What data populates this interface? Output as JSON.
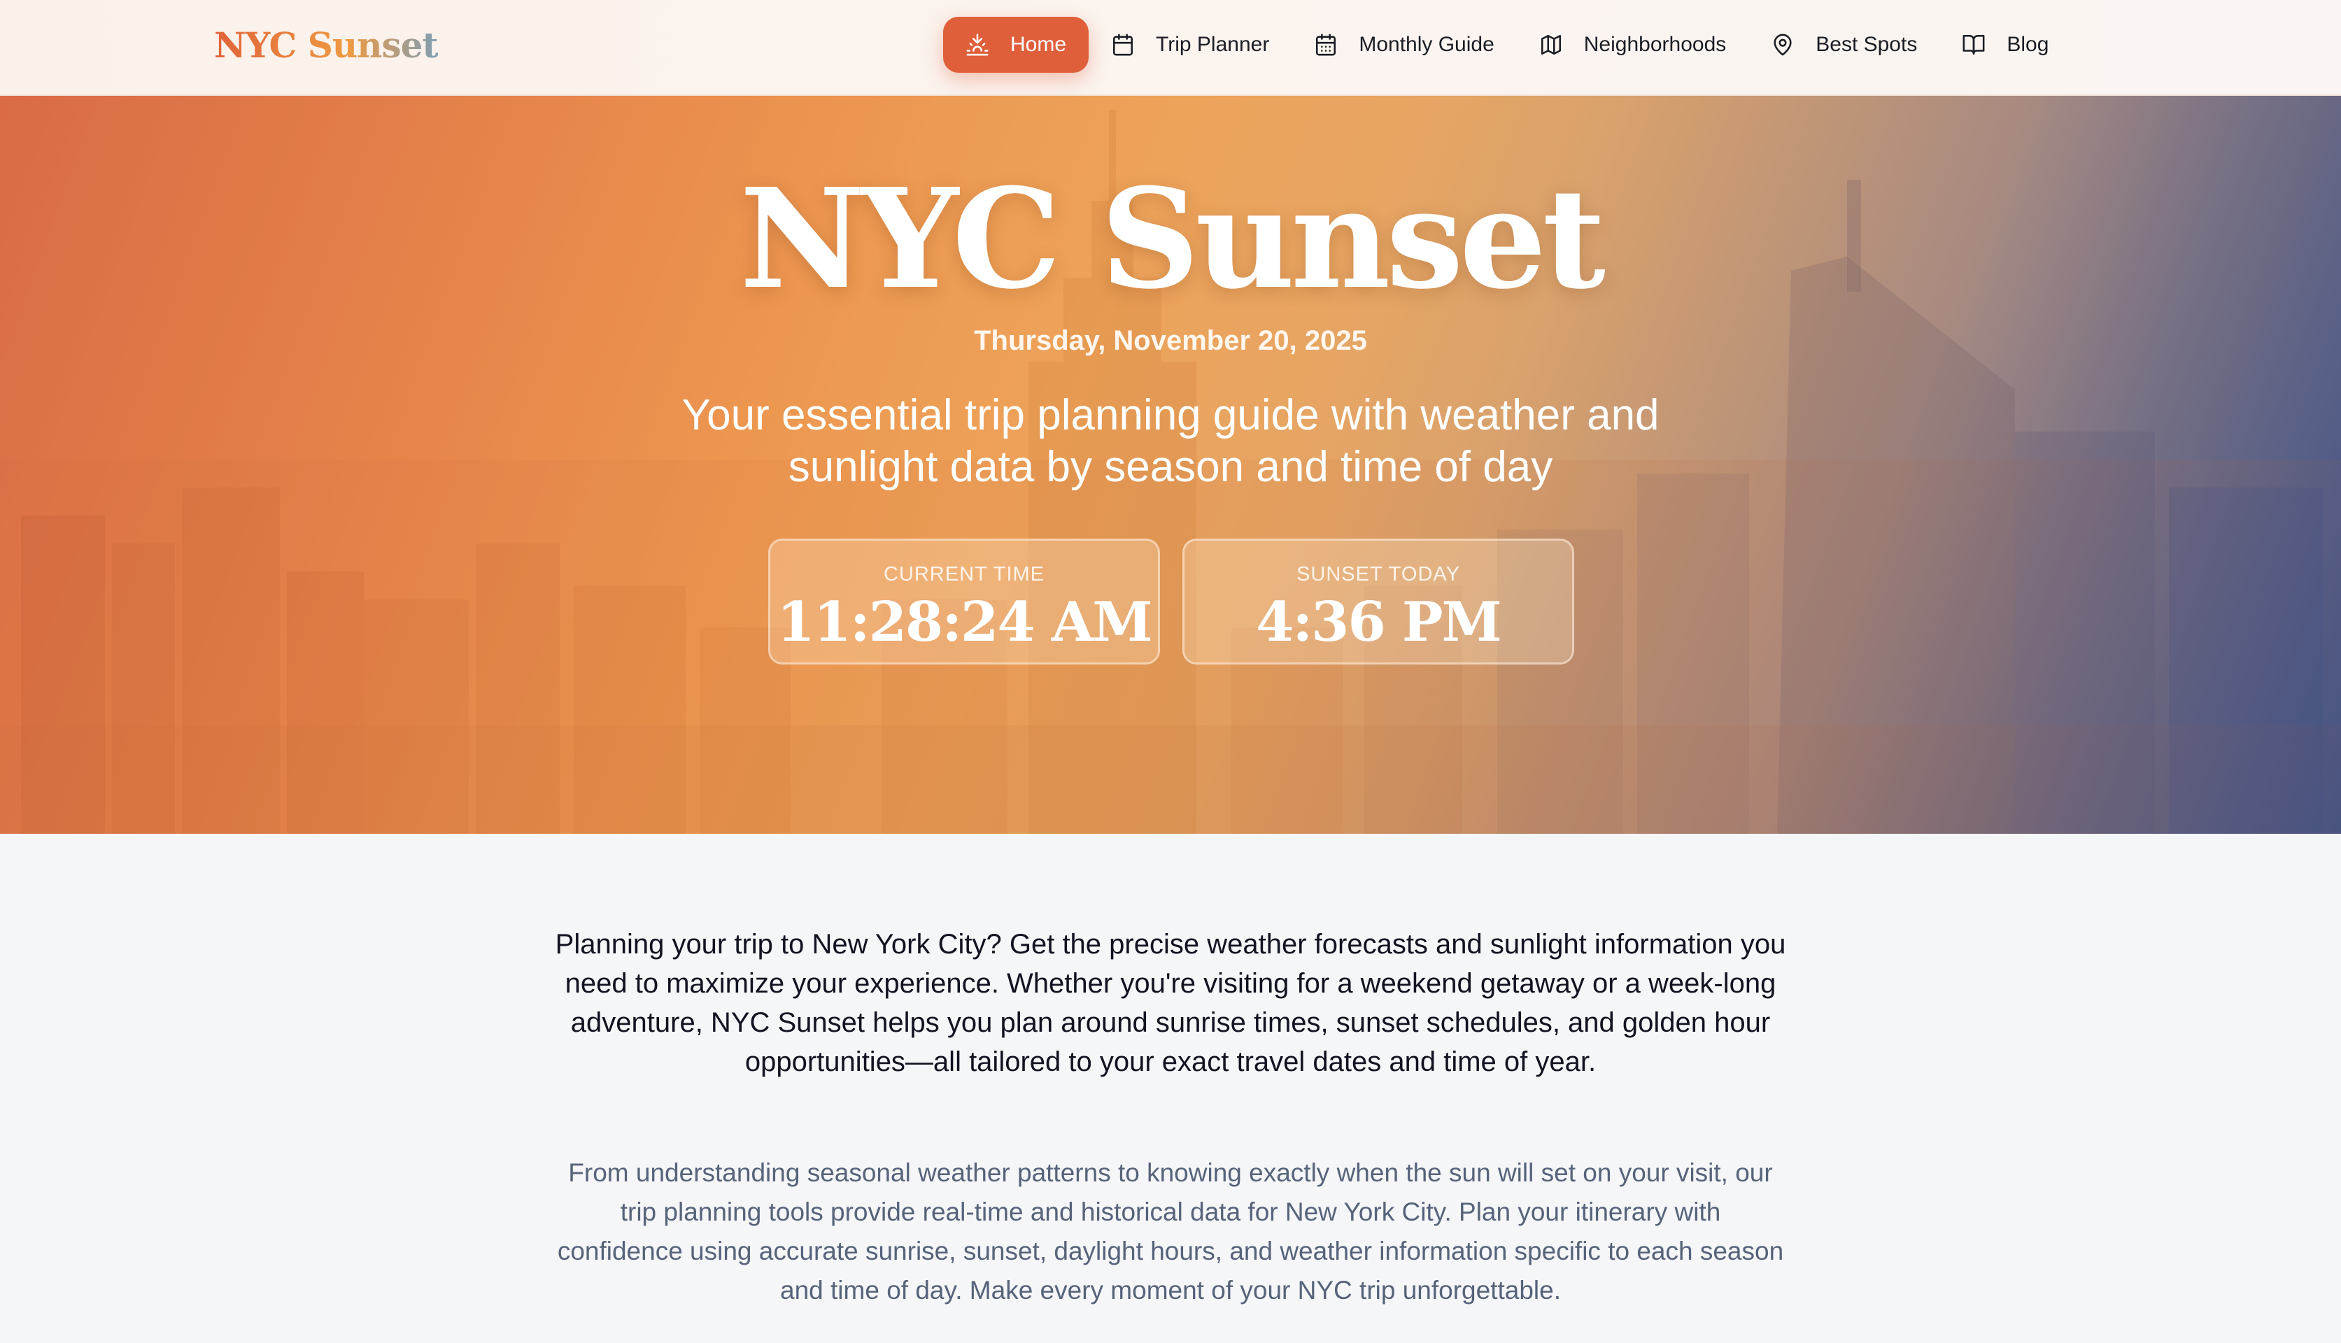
{
  "brand": "NYC Sunset",
  "nav": {
    "items": [
      {
        "label": "Home",
        "icon": "sunset-icon",
        "active": true
      },
      {
        "label": "Trip Planner",
        "icon": "calendar-icon",
        "active": false
      },
      {
        "label": "Monthly Guide",
        "icon": "calendar-grid-icon",
        "active": false
      },
      {
        "label": "Neighborhoods",
        "icon": "map-icon",
        "active": false
      },
      {
        "label": "Best Spots",
        "icon": "map-pin-icon",
        "active": false
      },
      {
        "label": "Blog",
        "icon": "book-open-icon",
        "active": false
      }
    ]
  },
  "hero": {
    "title": "NYC Sunset",
    "date": "Thursday, November 20, 2025",
    "subtitle": "Your essential trip planning guide with weather and sunlight data by season and time of day",
    "current_time": {
      "label": "CURRENT TIME",
      "value": "11:28:24 AM"
    },
    "sunset_today": {
      "label": "SUNSET TODAY",
      "value": "4:36 PM"
    }
  },
  "content": {
    "lead": "Planning your trip to New York City? Get the precise weather forecasts and sunlight information you need to maximize your experience. Whether you're visiting for a weekend getaway or a week-long adventure, NYC Sunset helps you plan around sunrise times, sunset schedules, and golden hour opportunities—all tailored to your exact travel dates and time of year.",
    "secondary": "From understanding seasonal weather patterns to knowing exactly when the sun will set on your visit, our trip planning tools provide real-time and historical data for New York City. Plan your itinerary with confidence using accurate sunrise, sunset, daylight hours, and weather information specific to each season and time of day. Make every moment of your NYC trip unforgettable."
  },
  "colors": {
    "accent": "#df5f3b",
    "hero_orange": "#ee9a48",
    "hero_blue": "#40528a",
    "body_text": "#111420",
    "muted_text": "#56637a"
  }
}
